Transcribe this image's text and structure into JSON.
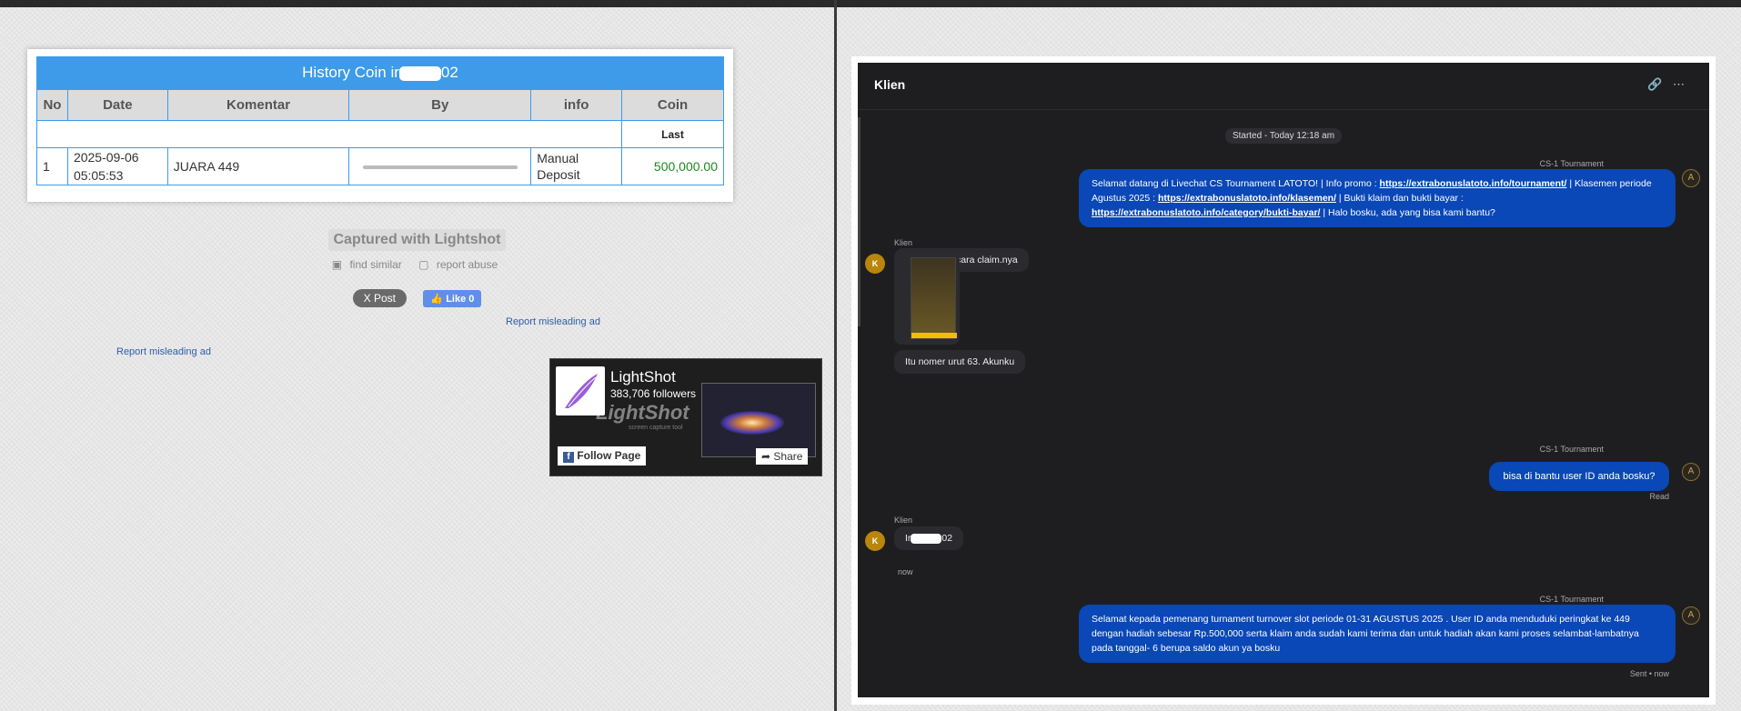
{
  "left": {
    "history": {
      "title_prefix": "History Coin ir",
      "title_suffix": "02",
      "columns": [
        "No",
        "Date",
        "Komentar",
        "By",
        "info",
        "Coin"
      ],
      "subheader": "Last",
      "rows": [
        {
          "no": "1",
          "date_line1": "2025-09-06",
          "date_line2": "05:05:53",
          "komentar": "JUARA 449",
          "by": "",
          "info_line1": "Manual",
          "info_line2": "Deposit",
          "coin": "500,000.00"
        }
      ]
    },
    "captured": "Captured with Lightshot",
    "find_similar": "find similar",
    "report_abuse": "report abuse",
    "post_label": "X Post",
    "like_label": "Like 0",
    "report_ad_1": "Report misleading ad",
    "report_ad_2": "Report misleading ad",
    "fb_widget": {
      "name": "LightShot",
      "followers": "383,706 followers",
      "watermark": "LightShot",
      "watermark_sub": "screen capture tool",
      "follow_label": "Follow Page",
      "share_label": "Share"
    }
  },
  "chat": {
    "title": "Klien",
    "started": "Started - Today 12:18 am",
    "messages": {
      "m1": {
        "sender": "CS-1 Tournament",
        "text_a": "Selamat datang di Livechat CS Tournament LATOTO! | Info promo : ",
        "link1": "https://extrabonuslatoto.info/tournament/",
        "text_b": " | Klasemen periode Agustus 2025 : ",
        "link2": "https://extrabonuslatoto.info/klasemen/",
        "text_c": " | Bukti klaim dan bukti bayar : ",
        "link3": "https://extrabonuslatoto.info/category/bukti-bayar/",
        "text_d": " | Halo bosku, ada yang bisa kami bantu?"
      },
      "m2": {
        "sender": "Klien",
        "avatar": "K",
        "text": "Bagaimana cara claim.nya"
      },
      "m3": {
        "text": "Itu nomer urut 63. Akunku"
      },
      "m4": {
        "sender": "CS-1 Tournament",
        "text": "bisa di bantu user ID anda bosku?",
        "status": "Read"
      },
      "m5": {
        "sender": "Klien",
        "avatar": "K",
        "text_prefix": "Ir",
        "text_suffix": "02",
        "time": "now"
      },
      "m6": {
        "sender": "CS-1 Tournament",
        "text": "Selamat kepada pemenang turnament turnover slot periode 01-31 AGUSTUS 2025 . User ID anda menduduki peringkat ke 449 dengan hadiah sebesar Rp.500,000 serta klaim anda sudah kami terima dan untuk hadiah akan kami proses selambat-lambatnya pada tanggal- 6 berupa saldo akun ya bosku",
        "status": "Sent • now"
      }
    }
  },
  "colors": {
    "accent_blue": "#3d9be9",
    "chat_bubble": "#0a47b7",
    "coin_green": "#1a8a1a"
  }
}
